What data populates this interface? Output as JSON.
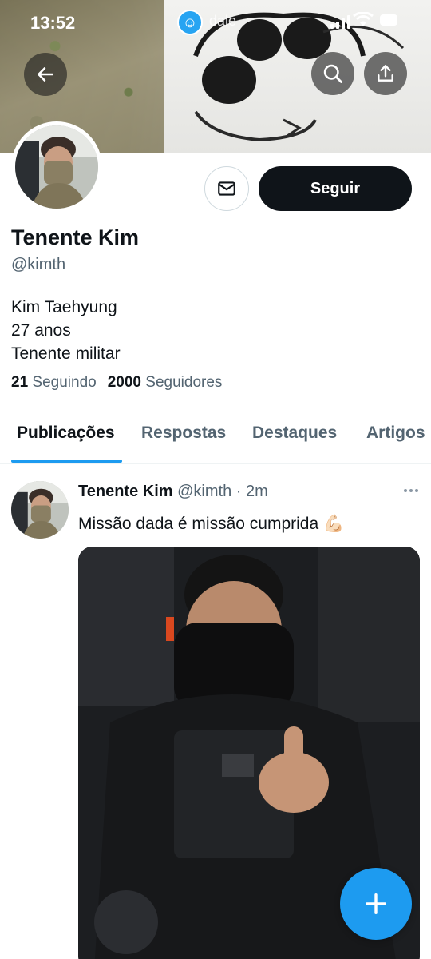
{
  "status_bar": {
    "time": "13:52",
    "app_label": "dale"
  },
  "profile": {
    "display_name": "Tenente Kim",
    "handle": "@kimth",
    "bio": [
      "Kim Taehyung",
      "27 anos",
      "Tenente militar"
    ],
    "following_count": "21",
    "following_label": "Seguindo",
    "followers_count": "2000",
    "followers_label": "Seguidores",
    "follow_button": "Seguir"
  },
  "tabs": [
    {
      "label": "Publicações",
      "active": true
    },
    {
      "label": "Respostas",
      "active": false
    },
    {
      "label": "Destaques",
      "active": false
    },
    {
      "label": "Artigos",
      "active": false
    }
  ],
  "tweet": {
    "author_name": "Tenente Kim",
    "author_handle": "@kimth",
    "separator": "·",
    "time_ago": "2m",
    "text": "Missão dada é missão cumprida 💪🏻"
  },
  "icons": {
    "back": "arrow-left-icon",
    "search": "search-icon",
    "share": "share-icon",
    "message": "envelope-icon",
    "more": "more-dots-icon",
    "compose": "plus-icon"
  },
  "colors": {
    "accent": "#1d9bf0",
    "text_primary": "#0f1419",
    "text_secondary": "#536471",
    "follow_button_bg": "#0f1419"
  }
}
